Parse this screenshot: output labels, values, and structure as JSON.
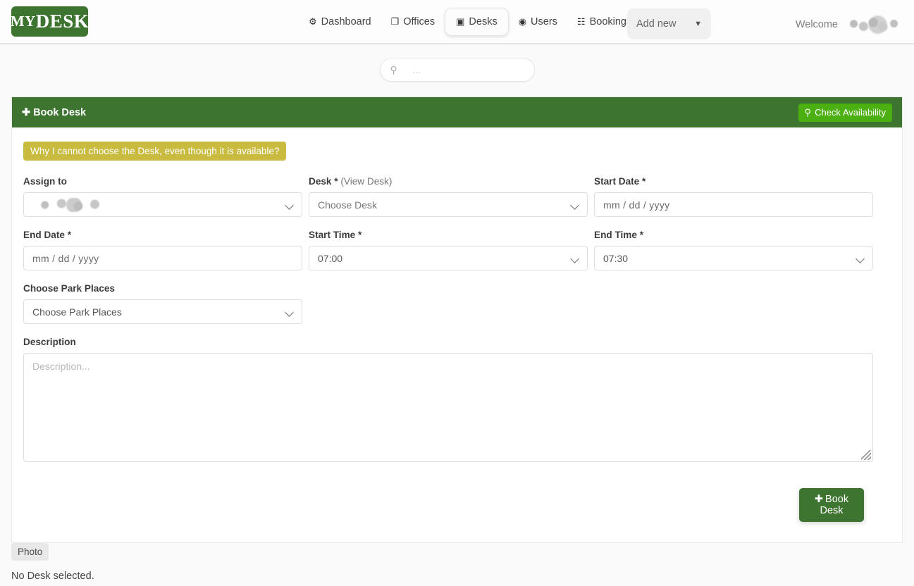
{
  "navbar": {
    "brand": {
      "my": "MY",
      "desk": "DESK"
    },
    "items": [
      {
        "label": "Dashboard",
        "icon": "dashboard-icon",
        "glyph": "⚙",
        "active": false
      },
      {
        "label": "Offices",
        "icon": "offices-icon",
        "glyph": "❐",
        "active": false
      },
      {
        "label": "Desks",
        "icon": "desk-monitor-icon",
        "glyph": "▣",
        "active": true
      },
      {
        "label": "Users",
        "icon": "user-circle-icon",
        "glyph": "◉",
        "active": false
      },
      {
        "label": "Bookings",
        "icon": "calendar-icon",
        "glyph": "☷",
        "active": false
      }
    ],
    "add_new": {
      "label": "Add new",
      "caret": "▼"
    },
    "welcome": {
      "label": "Welcome",
      "username": ""
    }
  },
  "search": {
    "icon": "search-icon",
    "glyph": "⚲",
    "placeholder": "...",
    "value": ""
  },
  "panel": {
    "title": "Book Desk",
    "title_plus": "✚",
    "check_availability": {
      "label": "Check Availability",
      "icon": "search-icon",
      "glyph": "⚲"
    },
    "alert": "Why I cannot choose the Desk, even though it is available?"
  },
  "form": {
    "assign_to": {
      "label": "Assign to",
      "value": "",
      "redacted": true
    },
    "desk": {
      "label": "Desk",
      "required": "*",
      "link": "(View Desk)",
      "value": "Choose Desk"
    },
    "start_date": {
      "label": "Start Date",
      "required": "*",
      "placeholder": "mm / dd / yyyy",
      "value": ""
    },
    "end_date": {
      "label": "End Date",
      "required": "*",
      "placeholder": "mm / dd / yyyy",
      "value": ""
    },
    "start_time": {
      "label": "Start Time",
      "required": "*",
      "value": "07:00"
    },
    "end_time": {
      "label": "End Time",
      "required": "*",
      "value": "07:30"
    },
    "park_places": {
      "label": "Choose Park Places",
      "value": "Choose Park Places"
    },
    "description": {
      "label": "Description",
      "placeholder": "Description...",
      "value": ""
    },
    "submit": {
      "label": "Book Desk",
      "plus": "✚"
    }
  },
  "footer": {
    "photo_tab": "Photo",
    "status": "No Desk selected."
  },
  "colors": {
    "brand_green": "#3d7430",
    "bright_green": "#4caf12",
    "alert_yellow": "#c9bb3f",
    "page_bg": "#fafafa"
  }
}
